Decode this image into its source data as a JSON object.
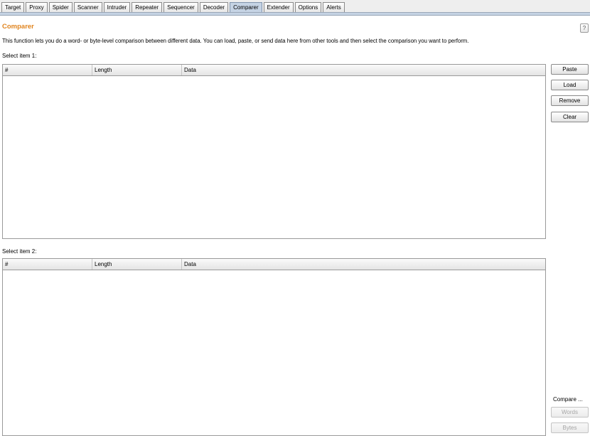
{
  "tabs": [
    "Target",
    "Proxy",
    "Spider",
    "Scanner",
    "Intruder",
    "Repeater",
    "Sequencer",
    "Decoder",
    "Comparer",
    "Extender",
    "Options",
    "Alerts"
  ],
  "active_tab": "Comparer",
  "header": {
    "title": "Comparer",
    "help_label": "?",
    "description": "This function lets you do a word- or byte-level comparison between different data. You can load, paste, or send data here from other tools and then select the comparison you want to perform."
  },
  "item1": {
    "label": "Select item 1:",
    "columns": [
      "#",
      "Length",
      "Data"
    ]
  },
  "item2": {
    "label": "Select item 2:",
    "columns": [
      "#",
      "Length",
      "Data"
    ]
  },
  "actions": {
    "paste": "Paste",
    "load": "Load",
    "remove": "Remove",
    "clear": "Clear"
  },
  "compare": {
    "label": "Compare ...",
    "words": "Words",
    "bytes": "Bytes"
  },
  "colors": {
    "title": "#e0841f",
    "active_tab": "#c5d3e4"
  }
}
